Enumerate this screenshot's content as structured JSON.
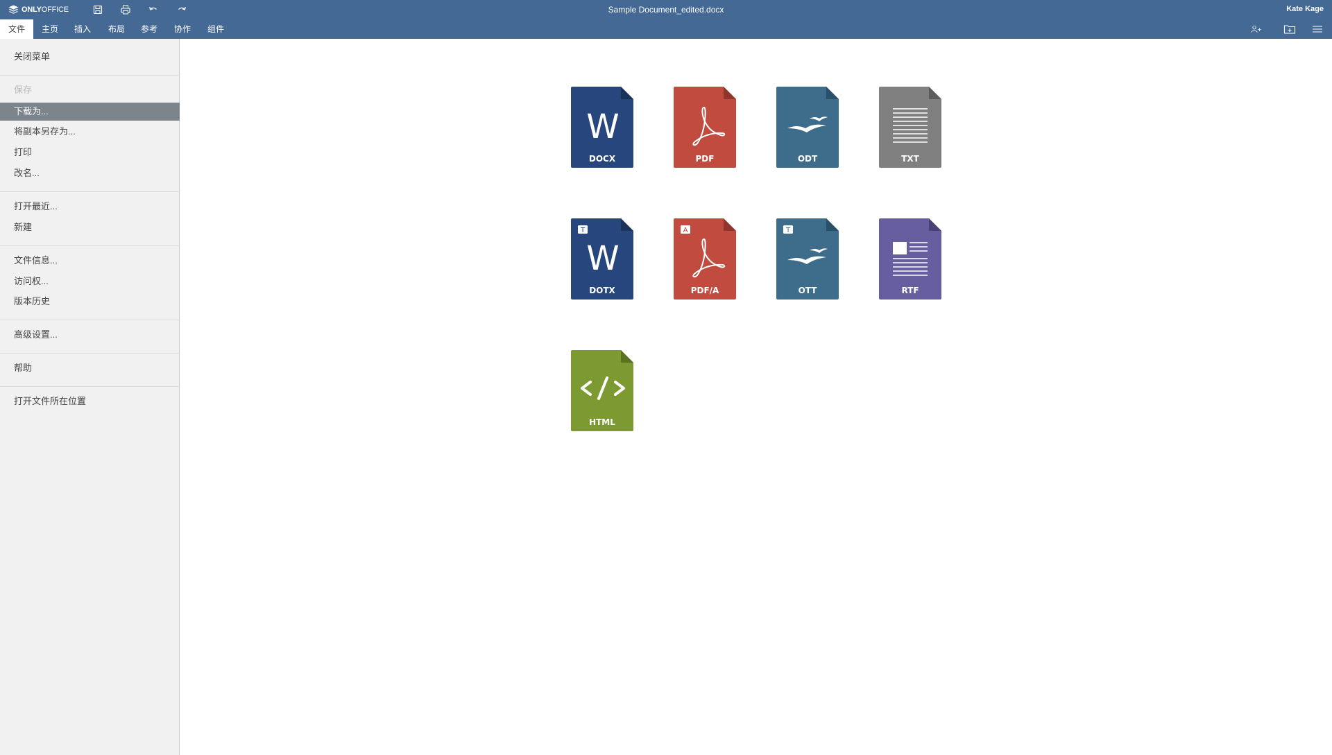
{
  "app": {
    "brand_text": "ONLYOFFICE",
    "document_title": "Sample Document_edited.docx",
    "user_name": "Kate Kage",
    "colors": {
      "header_bg": "#446995",
      "menu_bg": "#f1f1f1",
      "menu_selected_bg": "#7d858c"
    }
  },
  "toolbar": {
    "quick_access": [
      {
        "name": "save-icon"
      },
      {
        "name": "print-icon"
      },
      {
        "name": "undo-icon"
      },
      {
        "name": "redo-icon"
      }
    ],
    "right_icons": [
      {
        "name": "share-user-icon"
      },
      {
        "name": "open-location-icon"
      },
      {
        "name": "hamburger-menu-icon"
      }
    ]
  },
  "tabs": [
    {
      "label": "文件",
      "active": true
    },
    {
      "label": "主页"
    },
    {
      "label": "插入"
    },
    {
      "label": "布局"
    },
    {
      "label": "参考"
    },
    {
      "label": "协作"
    },
    {
      "label": "组件"
    }
  ],
  "file_menu": {
    "items": [
      {
        "label": "关闭菜单"
      },
      {
        "label": "保存",
        "disabled": true
      },
      {
        "label": "下载为...",
        "selected": true
      },
      {
        "label": "将副本另存为..."
      },
      {
        "label": "打印"
      },
      {
        "label": "改名..."
      },
      {
        "label": "打开最近..."
      },
      {
        "label": "新建"
      },
      {
        "label": "文件信息..."
      },
      {
        "label": "访问权..."
      },
      {
        "label": "版本历史"
      },
      {
        "label": "高级设置..."
      },
      {
        "label": "帮助"
      },
      {
        "label": "打开文件所在位置"
      }
    ]
  },
  "download_formats": [
    {
      "label": "DOCX",
      "color": "#27467d",
      "icon": "word-icon"
    },
    {
      "label": "PDF",
      "color": "#c04b3e",
      "icon": "pdf-icon"
    },
    {
      "label": "ODT",
      "color": "#3e6d8c",
      "icon": "openoffice-birds-icon"
    },
    {
      "label": "TXT",
      "color": "#808080",
      "icon": "text-lines-icon"
    },
    {
      "label": "DOTX",
      "color": "#27467d",
      "icon": "word-template-icon",
      "badge": "T"
    },
    {
      "label": "PDF/A",
      "color": "#c04b3e",
      "icon": "pdf-a-icon",
      "badge": "A"
    },
    {
      "label": "OTT",
      "color": "#3e6d8c",
      "icon": "openoffice-template-icon",
      "badge": "T"
    },
    {
      "label": "RTF",
      "color": "#675ea0",
      "icon": "rich-text-icon"
    },
    {
      "label": "HTML",
      "color": "#7c9a31",
      "icon": "html-code-icon"
    }
  ]
}
